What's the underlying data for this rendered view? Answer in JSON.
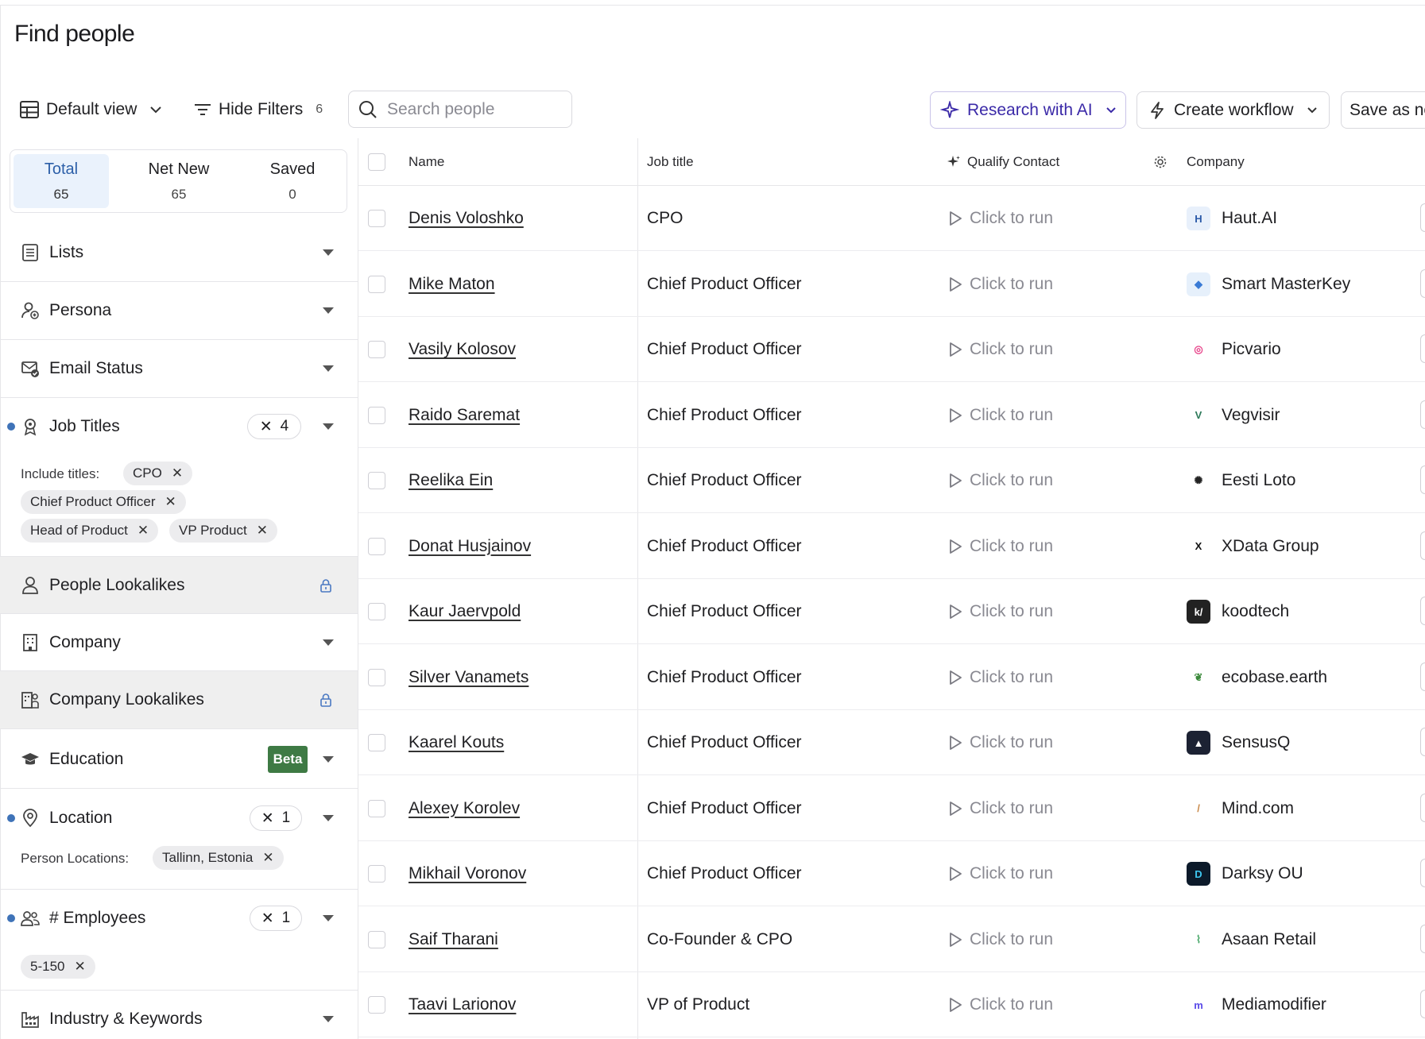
{
  "page": {
    "title": "Find people"
  },
  "toolbar": {
    "view_label": "Default view",
    "hide_filters_label": "Hide Filters",
    "hide_filters_count": "6",
    "search_placeholder": "Search people",
    "research_label": "Research with AI",
    "workflow_label": "Create workflow",
    "save_label": "Save as ne",
    "accent_color": "#3b2aa8"
  },
  "tabs": [
    {
      "label": "Total",
      "count": "65"
    },
    {
      "label": "Net New",
      "count": "65"
    },
    {
      "label": "Saved",
      "count": "0"
    }
  ],
  "filters": {
    "lists": "Lists",
    "persona": "Persona",
    "email_status": "Email Status",
    "job_titles": {
      "label": "Job Titles",
      "count": "4",
      "include_label": "Include titles:",
      "chips": [
        "CPO",
        "Chief Product Officer",
        "Head of Product",
        "VP Product"
      ]
    },
    "people_lookalikes": "People Lookalikes",
    "company": "Company",
    "company_lookalikes": "Company Lookalikes",
    "education": {
      "label": "Education",
      "badge": "Beta"
    },
    "location": {
      "label": "Location",
      "count": "1",
      "person_locations_label": "Person Locations:",
      "chips": [
        "Tallinn, Estonia"
      ]
    },
    "employees": {
      "label": "# Employees",
      "count": "1",
      "chips": [
        "5-150"
      ]
    },
    "industry": "Industry & Keywords"
  },
  "table": {
    "headers": {
      "name": "Name",
      "job_title": "Job title",
      "qualify": "Qualify Contact",
      "company": "Company"
    },
    "run_label": "Click to run",
    "rows": [
      {
        "name": "Denis Voloshko",
        "title": "CPO",
        "company": "Haut.AI"
      },
      {
        "name": "Mike Maton",
        "title": "Chief Product Officer",
        "company": "Smart MasterKey"
      },
      {
        "name": "Vasily Kolosov",
        "title": "Chief Product Officer",
        "company": "Picvario"
      },
      {
        "name": "Raido Saremat",
        "title": "Chief Product Officer",
        "company": "Vegvisir"
      },
      {
        "name": "Reelika Ein",
        "title": "Chief Product Officer",
        "company": "Eesti Loto"
      },
      {
        "name": "Donat Husjainov",
        "title": "Chief Product Officer",
        "company": "XData Group"
      },
      {
        "name": "Kaur Jaervpold",
        "title": "Chief Product Officer",
        "company": "koodtech"
      },
      {
        "name": "Silver Vanamets",
        "title": "Chief Product Officer",
        "company": "ecobase.earth"
      },
      {
        "name": "Kaarel Kouts",
        "title": "Chief Product Officer",
        "company": "SensusQ"
      },
      {
        "name": "Alexey Korolev",
        "title": "Chief Product Officer",
        "company": "Mind.com"
      },
      {
        "name": "Mikhail Voronov",
        "title": "Chief Product Officer",
        "company": "Darksy OU"
      },
      {
        "name": "Saif Tharani",
        "title": "Co-Founder & CPO",
        "company": "Asaan Retail"
      },
      {
        "name": "Taavi Larionov",
        "title": "VP of Product",
        "company": "Mediamodifier"
      }
    ]
  }
}
